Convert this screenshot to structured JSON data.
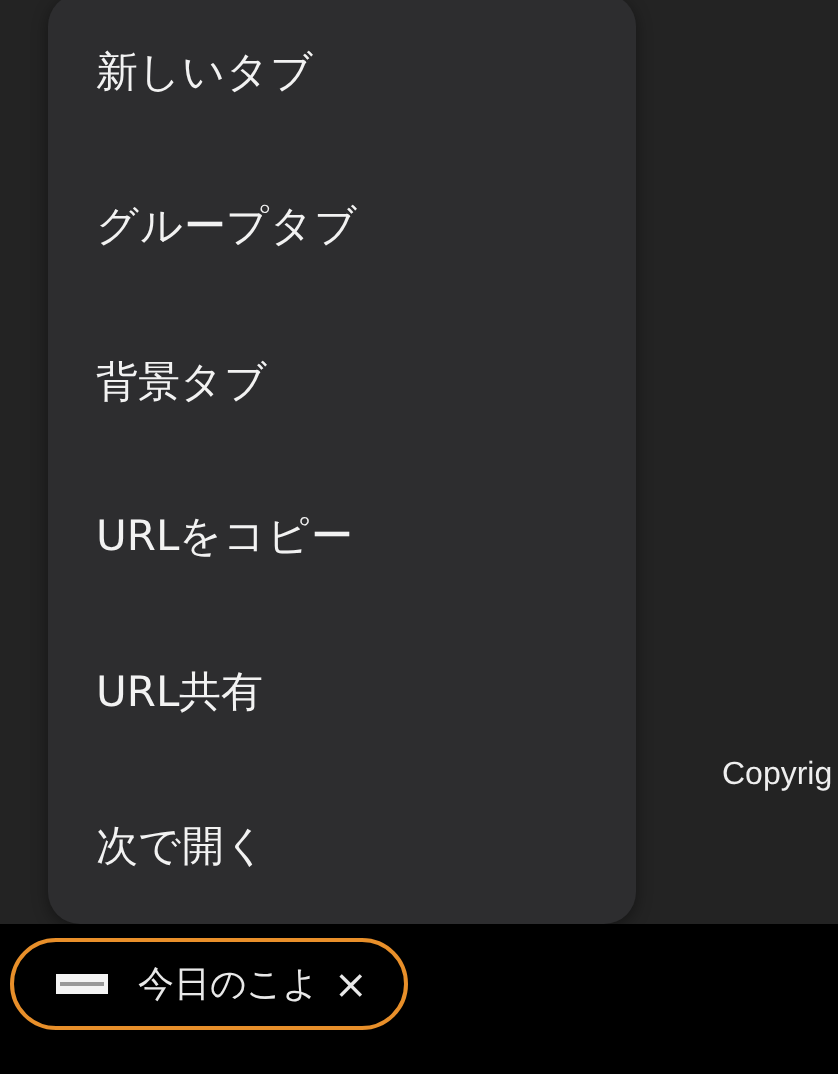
{
  "page": {
    "footer_text": "Copyrig"
  },
  "context_menu": {
    "items": [
      {
        "label": "新しいタブ"
      },
      {
        "label": "グループタブ"
      },
      {
        "label": "背景タブ"
      },
      {
        "label": "URLをコピー"
      },
      {
        "label": "URL共有"
      },
      {
        "label": "次で開く"
      }
    ]
  },
  "tab_bar": {
    "tabs": [
      {
        "title": "今日のこよ",
        "close": "×",
        "selected": true
      }
    ]
  }
}
